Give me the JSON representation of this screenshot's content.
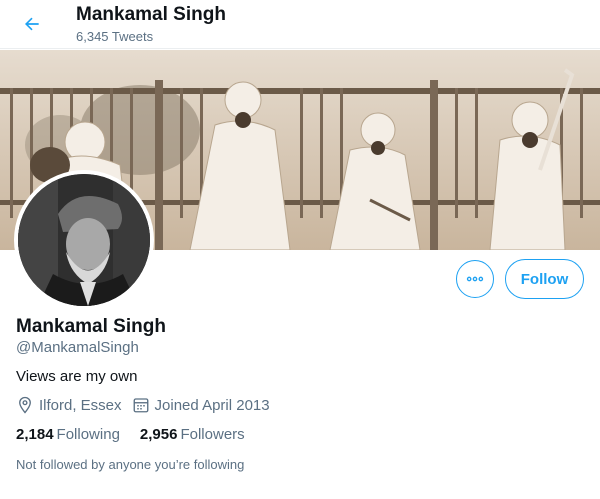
{
  "header": {
    "name": "Mankamal Singh",
    "tweet_count": "6,345 Tweets",
    "back_icon": "arrow-left-icon"
  },
  "banner": {
    "description": "banner-photo"
  },
  "profile": {
    "display_name": "Mankamal Singh",
    "handle": "@MankamalSingh",
    "bio": "Views are my own",
    "location": "Ilford, Essex",
    "joined": "Joined April 2013",
    "following_count": "2,184",
    "following_label": "Following",
    "followers_count": "2,956",
    "followers_label": "Followers",
    "not_followed_text": "Not followed by anyone you’re following"
  },
  "actions": {
    "follow_label": "Follow",
    "more_icon": "more-options-icon"
  },
  "colors": {
    "accent": "#1da1f2",
    "secondary_text": "#5b7083",
    "primary_text": "#0f1419"
  }
}
